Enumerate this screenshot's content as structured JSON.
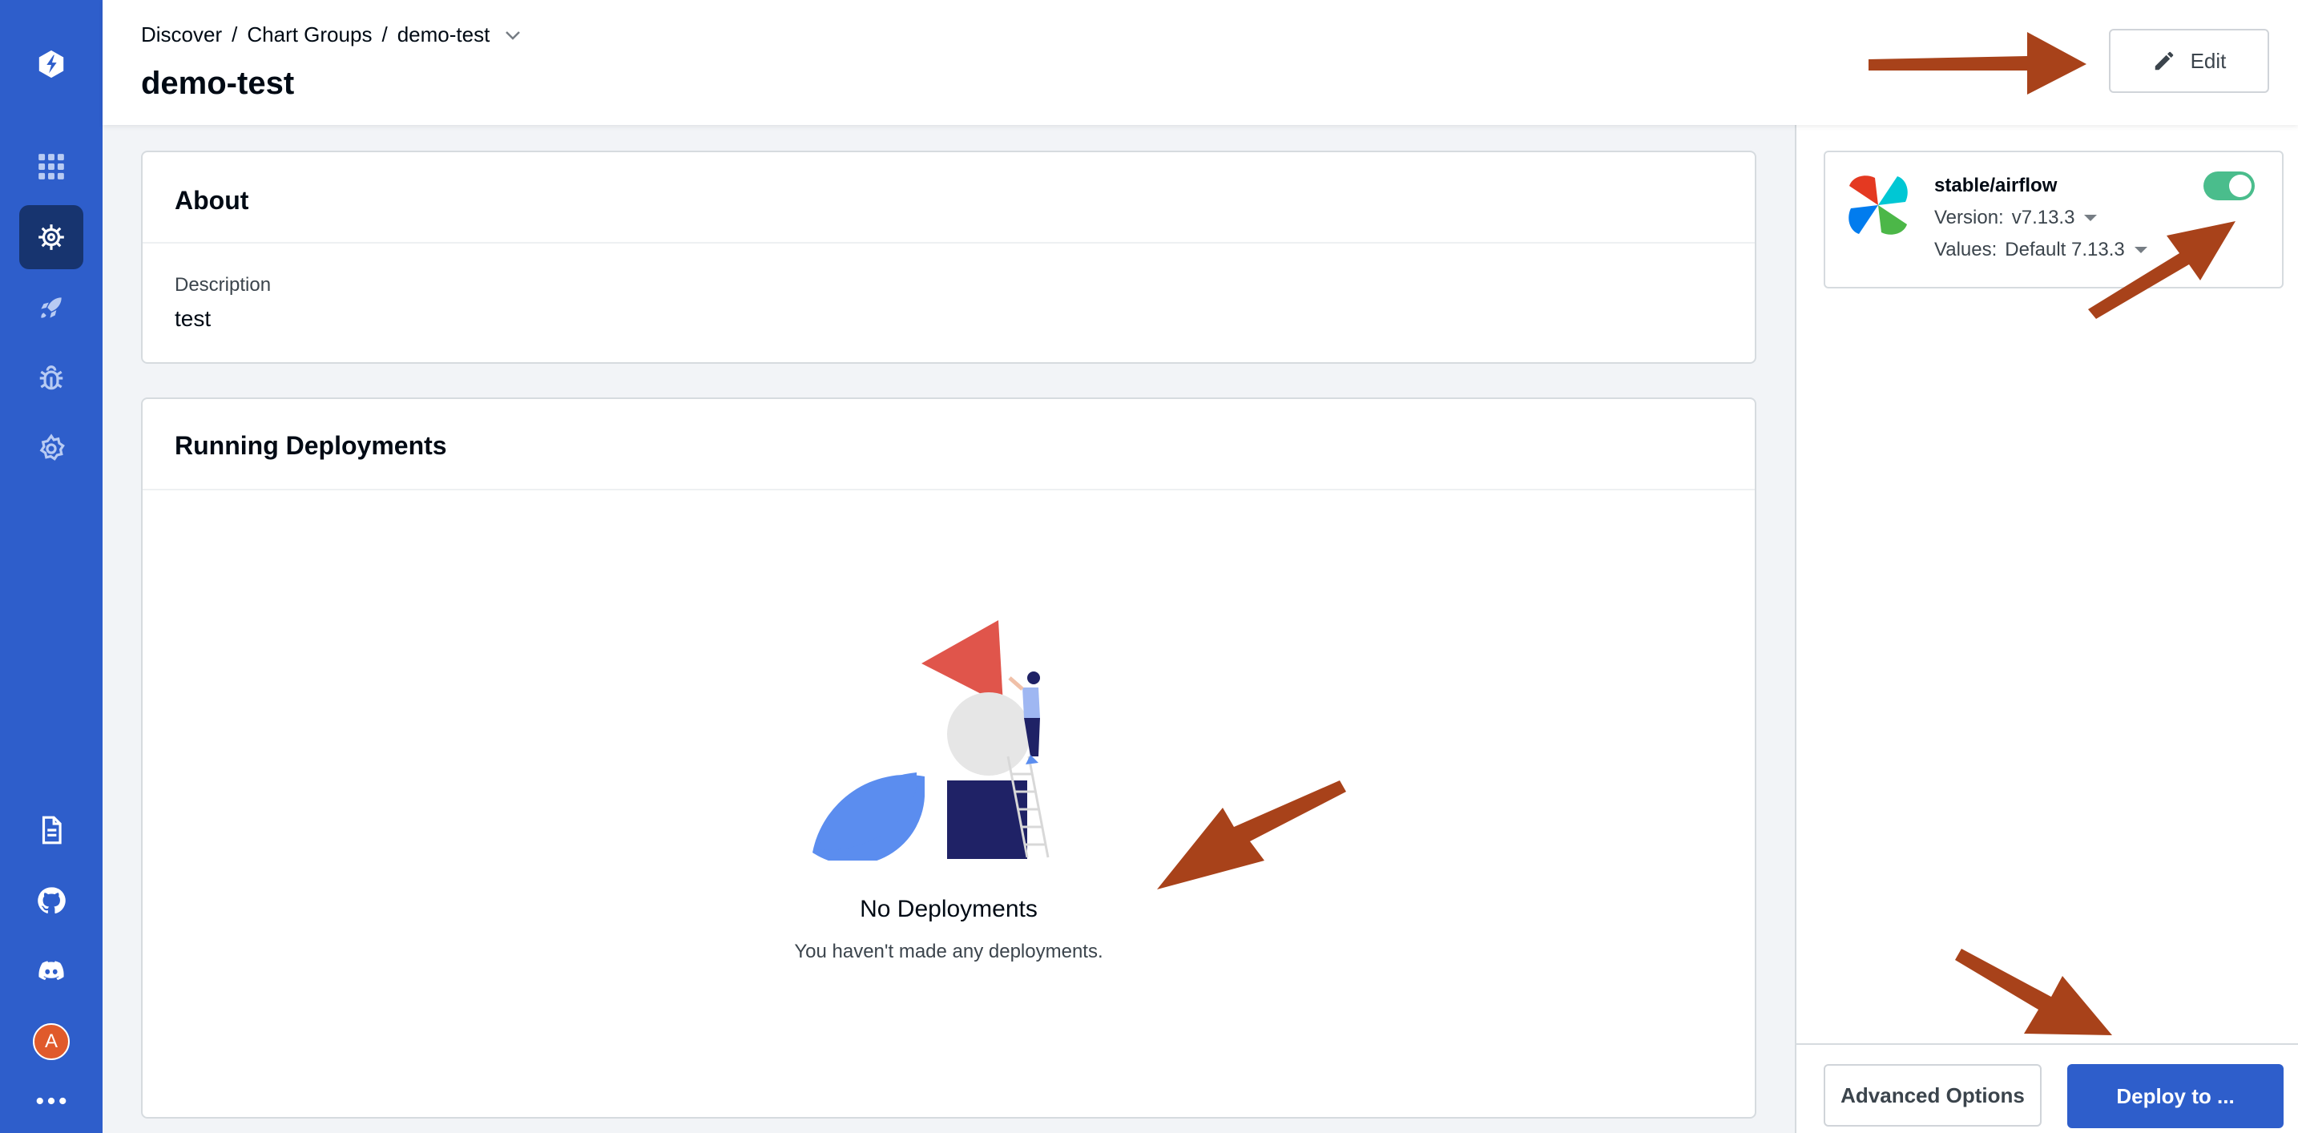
{
  "colors": {
    "sidebar": "#2e5ecb",
    "sidebar_active": "#17346f",
    "primary_button": "#2e5ecb",
    "toggle_on": "#1dad70",
    "annotation_arrow": "#a8421a",
    "avatar": "#e05a2b"
  },
  "sidebar": {
    "logo_icon": "devtron-logo-icon",
    "nav_items": [
      {
        "icon": "apps-grid-icon"
      },
      {
        "icon": "helm-wheel-icon",
        "active": true
      },
      {
        "icon": "rocket-icon"
      },
      {
        "icon": "bug-security-icon"
      },
      {
        "icon": "gear-icon"
      }
    ],
    "bottom_items": [
      {
        "icon": "document-icon"
      },
      {
        "icon": "github-icon"
      },
      {
        "icon": "discord-icon"
      }
    ],
    "avatar_letter": "A",
    "more_icon": "more-dots-icon"
  },
  "header": {
    "breadcrumb": [
      "Discover",
      "Chart Groups",
      "demo-test"
    ],
    "breadcrumb_separator": "/",
    "title": "demo-test",
    "edit_label": "Edit"
  },
  "about": {
    "title": "About",
    "description_label": "Description",
    "description_value": "test"
  },
  "running_deployments": {
    "title": "Running Deployments",
    "empty_title": "No Deployments",
    "empty_subtitle": "You haven't made any deployments."
  },
  "chart": {
    "name": "stable/airflow",
    "version_label": "Version:",
    "version_value": "v7.13.3",
    "values_label": "Values:",
    "values_value": "Default 7.13.3",
    "enabled": true
  },
  "footer": {
    "advanced_label": "Advanced Options",
    "deploy_label": "Deploy to ..."
  }
}
